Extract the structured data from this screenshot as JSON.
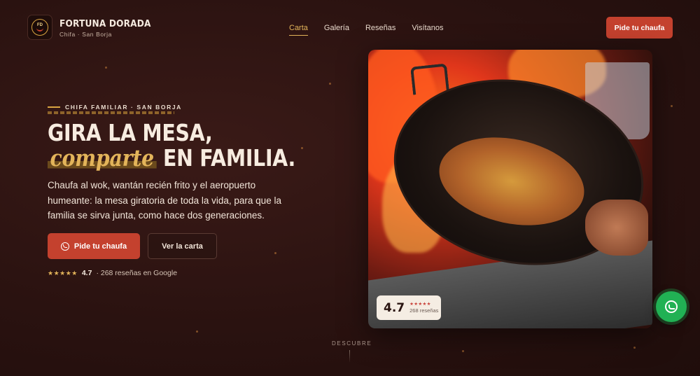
{
  "brand": {
    "logo_initials": "FD",
    "name": "FORTUNA DORADA",
    "tagline": "Chifa · San Borja"
  },
  "nav": {
    "items": [
      {
        "label": "Carta",
        "active": true
      },
      {
        "label": "Galería",
        "active": false
      },
      {
        "label": "Reseñas",
        "active": false
      },
      {
        "label": "Visítanos",
        "active": false
      }
    ]
  },
  "header": {
    "cta_label": "Pide tu chaufa"
  },
  "hero": {
    "eyebrow": "CHIFA FAMILIAR · SAN BORJA",
    "headline_line1": "GIRA LA MESA,",
    "headline_accent": "comparte",
    "headline_line2_rest": "EN FAMILIA.",
    "lead": "Chaufa al wok, wantán recién frito y el aeropuerto humeante: la mesa giratoria de toda la vida, para que la familia se sirva junta, como hace dos generaciones.",
    "primary_cta": "Pide tu chaufa",
    "secondary_cta": "Ver la carta",
    "rating": {
      "stars": "★★★★★",
      "value": "4.7",
      "count_text": "· 268 reseñas en Google"
    }
  },
  "image_badge": {
    "value": "4.7",
    "stars": "★★★★★",
    "count_text": "268 reseñas"
  },
  "scroll_hint": "DESCUBRE",
  "colors": {
    "background": "#2a1210",
    "accent_gold": "#e3b45a",
    "cta_red": "#c4412e",
    "whatsapp_green": "#21b154"
  },
  "icons": {
    "whatsapp": "whatsapp-icon",
    "float_whatsapp": "whatsapp-icon"
  }
}
